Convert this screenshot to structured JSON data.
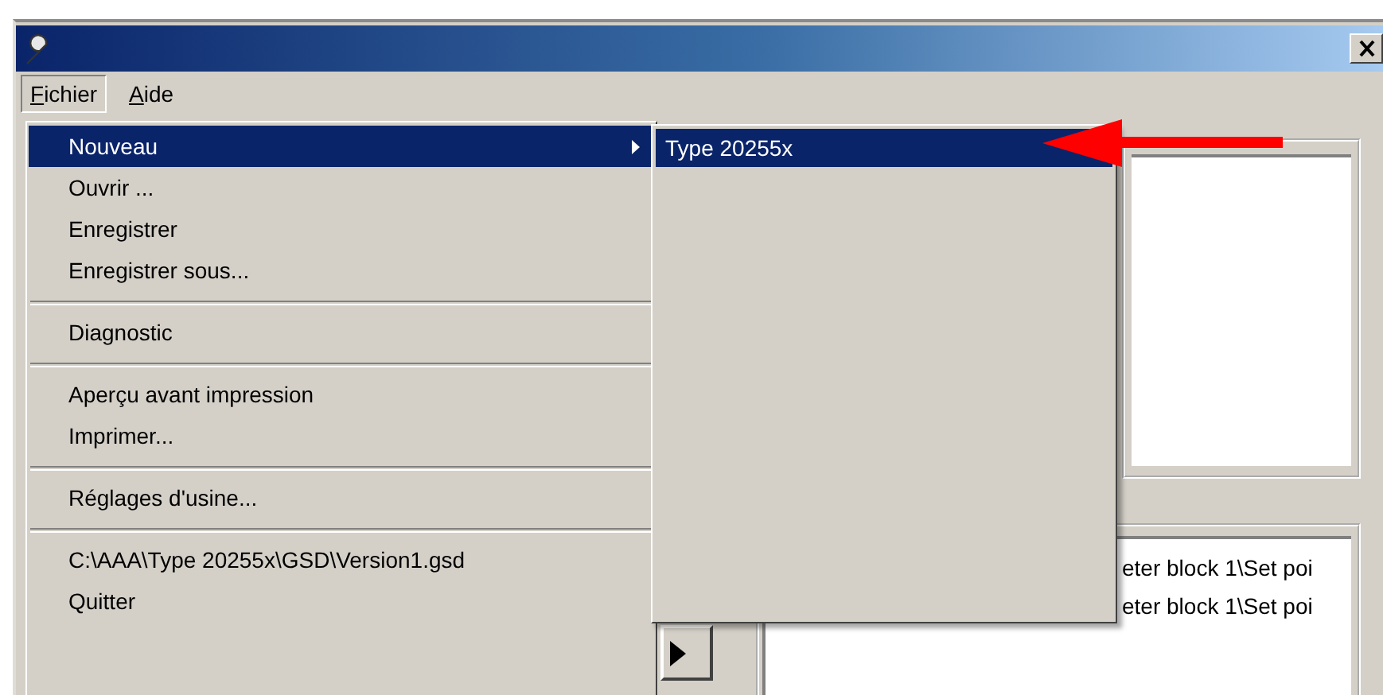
{
  "menu_bar": [
    {
      "label": "Fichier",
      "selected": true
    },
    {
      "label": "Aide",
      "selected": false
    }
  ],
  "menu": [
    {
      "kind": "item",
      "label": "Nouveau",
      "submenu": true,
      "selected": true
    },
    {
      "kind": "item",
      "label": "Ouvrir ...",
      "submenu": false,
      "selected": false
    },
    {
      "kind": "item",
      "label": "Enregistrer",
      "submenu": false,
      "selected": false
    },
    {
      "kind": "item",
      "label": "Enregistrer sous...",
      "submenu": false,
      "selected": false
    },
    {
      "kind": "separator"
    },
    {
      "kind": "item",
      "label": "Diagnostic",
      "submenu": false,
      "selected": false
    },
    {
      "kind": "separator"
    },
    {
      "kind": "item",
      "label": "Aperçu avant impression",
      "submenu": false,
      "selected": false
    },
    {
      "kind": "item",
      "label": "Imprimer...",
      "submenu": false,
      "selected": false
    },
    {
      "kind": "separator"
    },
    {
      "kind": "item",
      "label": "Réglages d'usine...",
      "submenu": false,
      "selected": false
    },
    {
      "kind": "separator"
    },
    {
      "kind": "item",
      "label": "C:\\AAA\\Type 20255x\\GSD\\Version1.gsd",
      "submenu": false,
      "selected": false
    },
    {
      "kind": "item",
      "label": "Quitter",
      "submenu": false,
      "selected": false
    }
  ],
  "submenu": [
    {
      "label": "Type 20255x",
      "selected": true
    }
  ],
  "lower_list": {
    "rows": [
      "eter block 1\\Set poi",
      "eter block 1\\Set poi"
    ]
  }
}
